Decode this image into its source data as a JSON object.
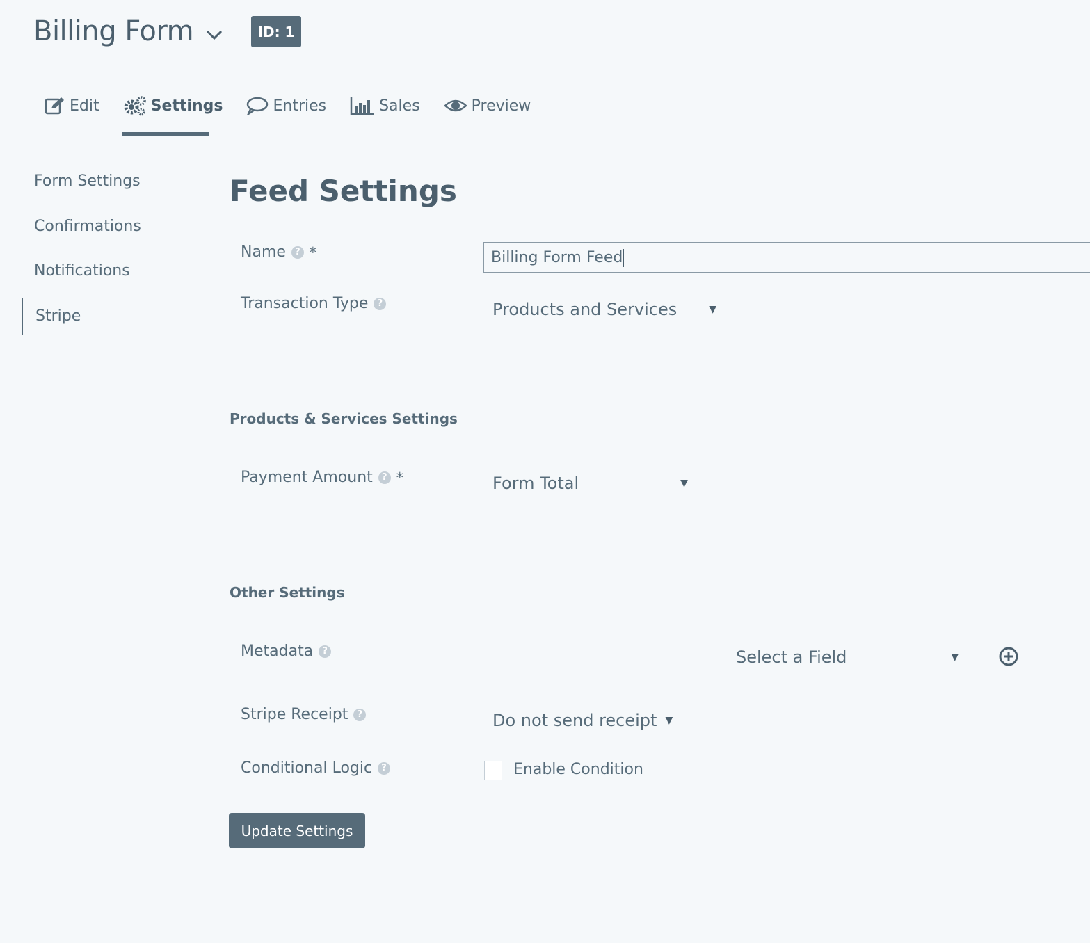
{
  "header": {
    "form_title": "Billing Form",
    "id_badge": "ID: 1"
  },
  "tabs": [
    {
      "label": "Edit",
      "icon": "edit-icon"
    },
    {
      "label": "Settings",
      "icon": "gear-icon"
    },
    {
      "label": "Entries",
      "icon": "comment-icon"
    },
    {
      "label": "Sales",
      "icon": "chart-icon"
    },
    {
      "label": "Preview",
      "icon": "eye-icon"
    }
  ],
  "sidebar": {
    "items": [
      {
        "label": "Form Settings"
      },
      {
        "label": "Confirmations"
      },
      {
        "label": "Notifications"
      },
      {
        "label": "Stripe"
      }
    ]
  },
  "main": {
    "title": "Feed Settings",
    "fields": {
      "name": {
        "label": "Name",
        "required": "*",
        "value": "Billing Form Feed"
      },
      "transaction_type": {
        "label": "Transaction Type",
        "value": "Products and Services"
      },
      "payment_amount": {
        "label": "Payment Amount",
        "required": "*",
        "value": "Form Total"
      },
      "metadata": {
        "label": "Metadata",
        "value": "Select a Field"
      },
      "stripe_receipt": {
        "label": "Stripe Receipt",
        "value": "Do not send receipt"
      },
      "conditional_logic": {
        "label": "Conditional Logic",
        "checkbox_label": "Enable Condition"
      }
    },
    "sections": {
      "products": "Products & Services Settings",
      "other": "Other Settings"
    },
    "help_glyph": "?",
    "dropdown_arrow": "▼",
    "submit_label": "Update Settings"
  },
  "colors": {
    "background": "#f5f8fa",
    "primary": "#566b79",
    "text": "#4b5f6d"
  }
}
